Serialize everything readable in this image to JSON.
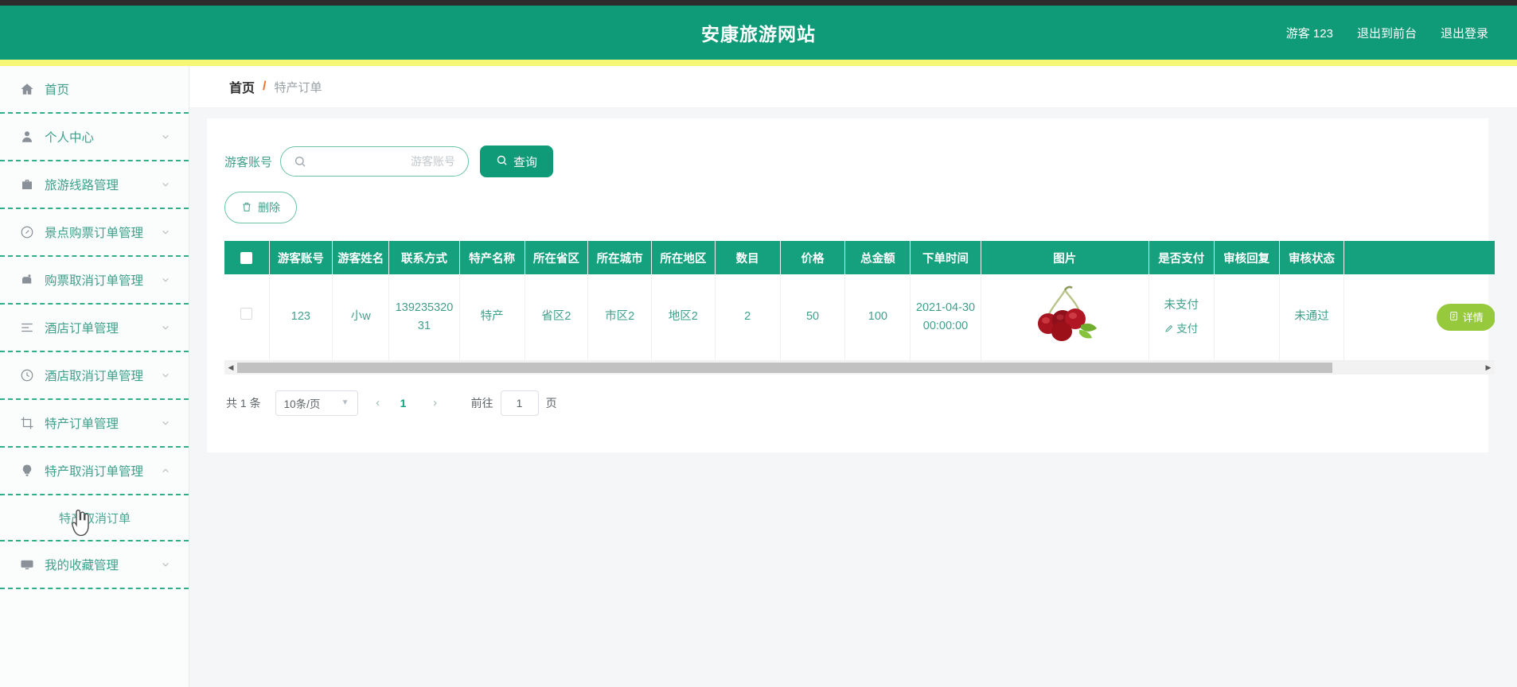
{
  "header": {
    "title": "安康旅游网站",
    "links": [
      {
        "label": "游客 123",
        "name": "current-user"
      },
      {
        "label": "退出到前台",
        "name": "exit-to-frontend"
      },
      {
        "label": "退出登录",
        "name": "logout"
      }
    ],
    "bg_color": "#0f9a78",
    "accent_strip_color": "#f7f776"
  },
  "sidebar": {
    "items": [
      {
        "label": "首页",
        "icon": "home-icon",
        "expandable": false
      },
      {
        "label": "个人中心",
        "icon": "user-icon",
        "expandable": true
      },
      {
        "label": "旅游线路管理",
        "icon": "briefcase-icon",
        "expandable": true
      },
      {
        "label": "景点购票订单管理",
        "icon": "clock-circle-icon",
        "expandable": true
      },
      {
        "label": "购票取消订单管理",
        "icon": "ticket-icon",
        "expandable": true
      },
      {
        "label": "酒店订单管理",
        "icon": "list-icon",
        "expandable": true
      },
      {
        "label": "酒店取消订单管理",
        "icon": "time-icon",
        "expandable": true
      },
      {
        "label": "特产订单管理",
        "icon": "crop-icon",
        "expandable": true
      },
      {
        "label": "特产取消订单管理",
        "icon": "bulb-icon",
        "expandable": true,
        "expanded": true
      },
      {
        "label": "我的收藏管理",
        "icon": "monitor-icon",
        "expandable": true
      }
    ],
    "submenu": {
      "label": "特产取消订单",
      "parent": "特产取消订单管理"
    }
  },
  "breadcrumb": {
    "home": "首页",
    "separator": "/",
    "current": "特产订单"
  },
  "search": {
    "label": "游客账号",
    "placeholder": "游客账号",
    "value": "",
    "query_button": "查询",
    "delete_button": "删除"
  },
  "table": {
    "columns": [
      "",
      "游客账号",
      "游客姓名",
      "联系方式",
      "特产名称",
      "所在省区",
      "所在城市",
      "所在地区",
      "数目",
      "价格",
      "总金额",
      "下单时间",
      "图片",
      "是否支付",
      "审核回复",
      "审核状态",
      ""
    ],
    "rows": [
      {
        "游客账号": "123",
        "游客姓名": "小w",
        "联系方式": "13923532031",
        "特产名称": "特产",
        "所在省区": "省区2",
        "所在城市": "市区2",
        "所在地区": "地区2",
        "数目": "2",
        "价格": "50",
        "总金额": "100",
        "下单时间": "2021-04-30 00:00:00",
        "图片": "cherries-image",
        "是否支付": "未支付",
        "支付链接": "支付",
        "审核回复": "",
        "审核状态": "未通过",
        "操作": [
          "详情",
          "详情"
        ]
      }
    ]
  },
  "pagination": {
    "total_text": "共 1 条",
    "page_size": "10条/页",
    "prev": "‹",
    "next": "›",
    "current_page": "1",
    "goto_label": "前往",
    "goto_value": "1",
    "page_unit": "页"
  },
  "colors": {
    "primary_green": "#0f9a78",
    "table_header_green": "#15a07e",
    "text_green": "#3fa08c",
    "action_button_green": "#97c93d",
    "breadcrumb_separator": "#ef6c28"
  }
}
